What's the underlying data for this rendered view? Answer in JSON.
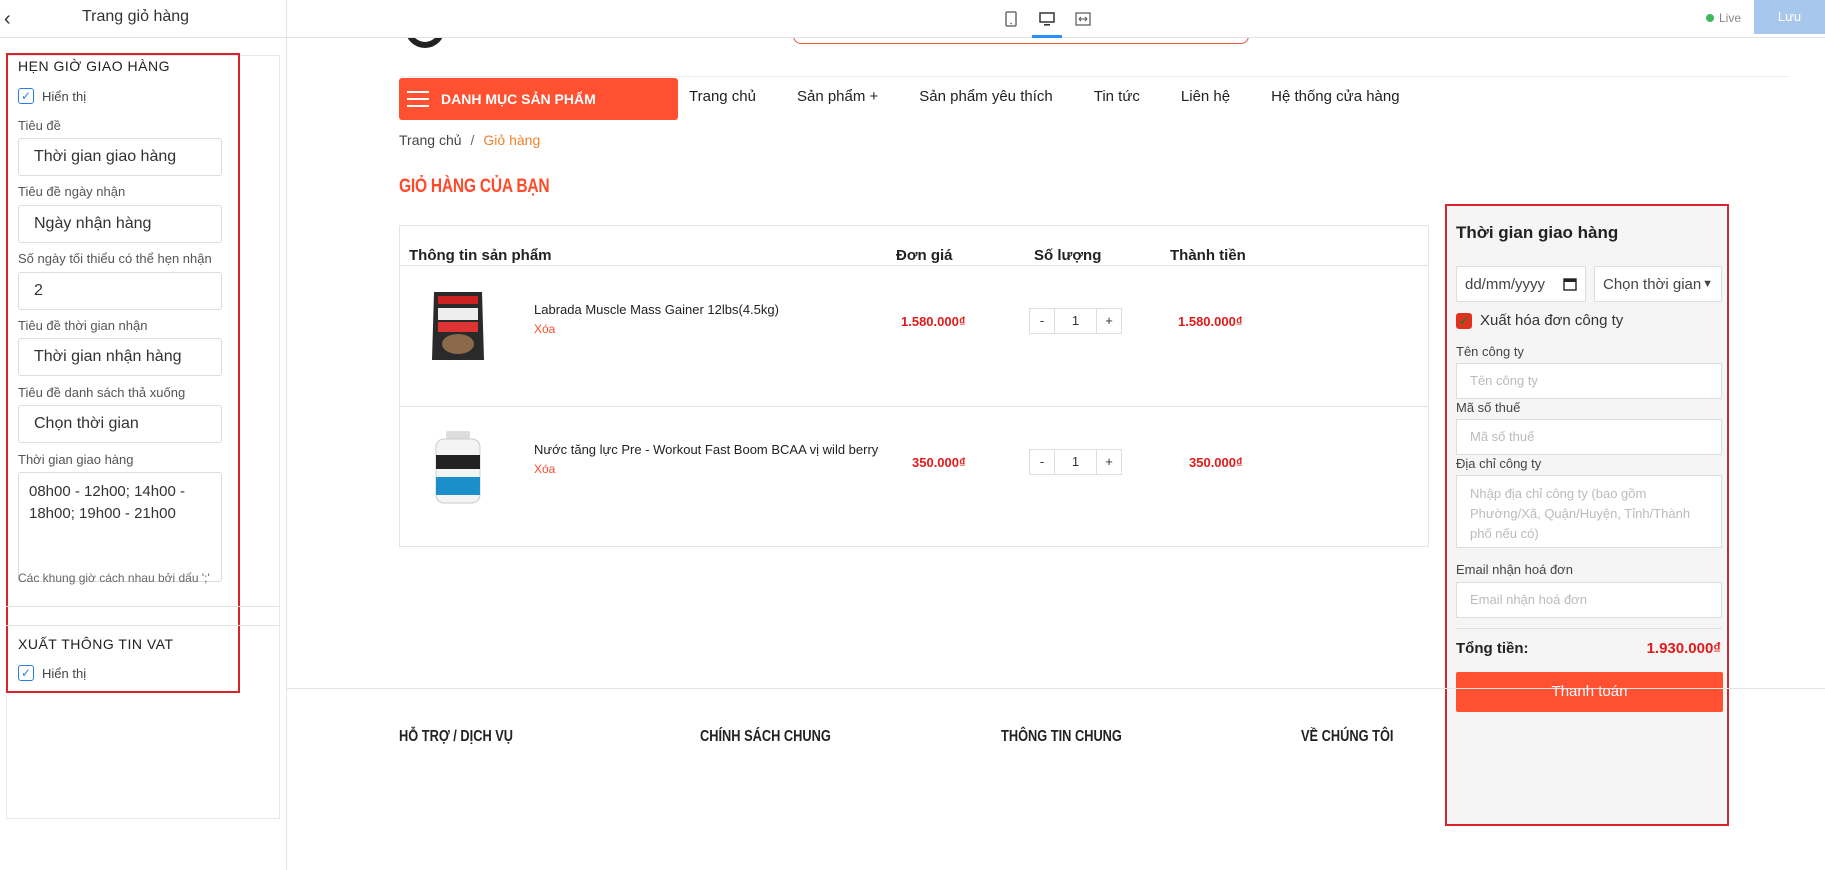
{
  "topbar": {
    "panel_title": "Trang giỏ hàng",
    "device_icons": [
      "tablet-icon",
      "desktop-icon",
      "fullwidth-icon"
    ],
    "live_label": "Live",
    "save_label": "Lưu"
  },
  "settings": {
    "delivery_section": {
      "title": "HẸN GIỜ GIAO HÀNG",
      "show_label": "Hiển thị",
      "show_checked": true,
      "title_label": "Tiêu đề",
      "title_value": "Thời gian giao hàng",
      "date_title_label": "Tiêu đề ngày nhận",
      "date_title_value": "Ngày nhận hàng",
      "min_days_label": "Số ngày tối thiểu có thể hẹn nhận",
      "min_days_value": "2",
      "time_title_label": "Tiêu đề thời gian nhận",
      "time_title_value": "Thời gian nhận hàng",
      "dropdown_title_label": "Tiêu đề danh sách thả xuống",
      "dropdown_title_value": "Chọn thời gian",
      "slots_label": "Thời gian giao hàng",
      "slots_value": "08h00 - 12h00; 14h00 - 18h00; 19h00 - 21h00",
      "slots_hint": "Các khung giờ cách nhau bởi dấu ';'"
    },
    "vat_section": {
      "title": "XUẤT THÔNG TIN VAT",
      "show_label": "Hiển thị",
      "show_checked": true
    }
  },
  "store": {
    "category_button": "DANH MỤC SẢN PHẨM",
    "nav": [
      "Trang chủ",
      "Sản phẩm +",
      "Sản phẩm yêu thích",
      "Tin tức",
      "Liên hệ",
      "Hệ thống cửa hàng"
    ],
    "breadcrumb": {
      "home": "Trang chủ",
      "separator": "/",
      "current": "Giỏ hàng"
    },
    "cart_title": "GIỎ HÀNG CỦA BẠN",
    "table_headers": {
      "product": "Thông tin sản phẩm",
      "price": "Đơn giá",
      "quantity": "Số lượng",
      "total": "Thành tiền"
    },
    "items": [
      {
        "name": "Labrada Muscle Mass Gainer 12lbs(4.5kg)",
        "remove": "Xóa",
        "price": "1.580.000₫",
        "qty": "1",
        "total": "1.580.000₫",
        "minus": "-",
        "plus": "+"
      },
      {
        "name": "Nước tăng lực Pre - Workout Fast Boom BCAA vị wild berry",
        "remove": "Xóa",
        "price": "350.000₫",
        "qty": "1",
        "total": "350.000₫",
        "minus": "-",
        "plus": "+"
      }
    ],
    "checkout": {
      "title": "Thời gian giao hàng",
      "date_placeholder": "dd/mm/yyyy",
      "time_select": "Chọn thời gian",
      "invoice_label": "Xuất hóa đơn công ty",
      "invoice_checked": true,
      "company_label": "Tên công ty",
      "company_placeholder": "Tên công ty",
      "tax_label": "Mã số thuế",
      "tax_placeholder": "Mã số thuế",
      "address_label": "Địa chỉ công ty",
      "address_placeholder": "Nhập địa chỉ công ty (bao gồm Phường/Xã, Quận/Huyện, Tỉnh/Thành phố nếu có)",
      "email_label": "Email nhận hoá đơn",
      "email_placeholder": "Email nhận hoá đơn",
      "total_label": "Tổng tiền:",
      "total_value": "1.930.000₫",
      "pay_button": "Thanh toán"
    },
    "footer_headings": [
      "HỖ TRỢ / DỊCH VỤ",
      "CHÍNH SÁCH CHUNG",
      "THÔNG TIN CHUNG",
      "VỀ CHÚNG TÔI"
    ]
  },
  "colors": {
    "accent": "#ff5031",
    "price": "#e21a1a",
    "highlight_box": "#d9232d",
    "link_blue": "#2b7de9"
  }
}
